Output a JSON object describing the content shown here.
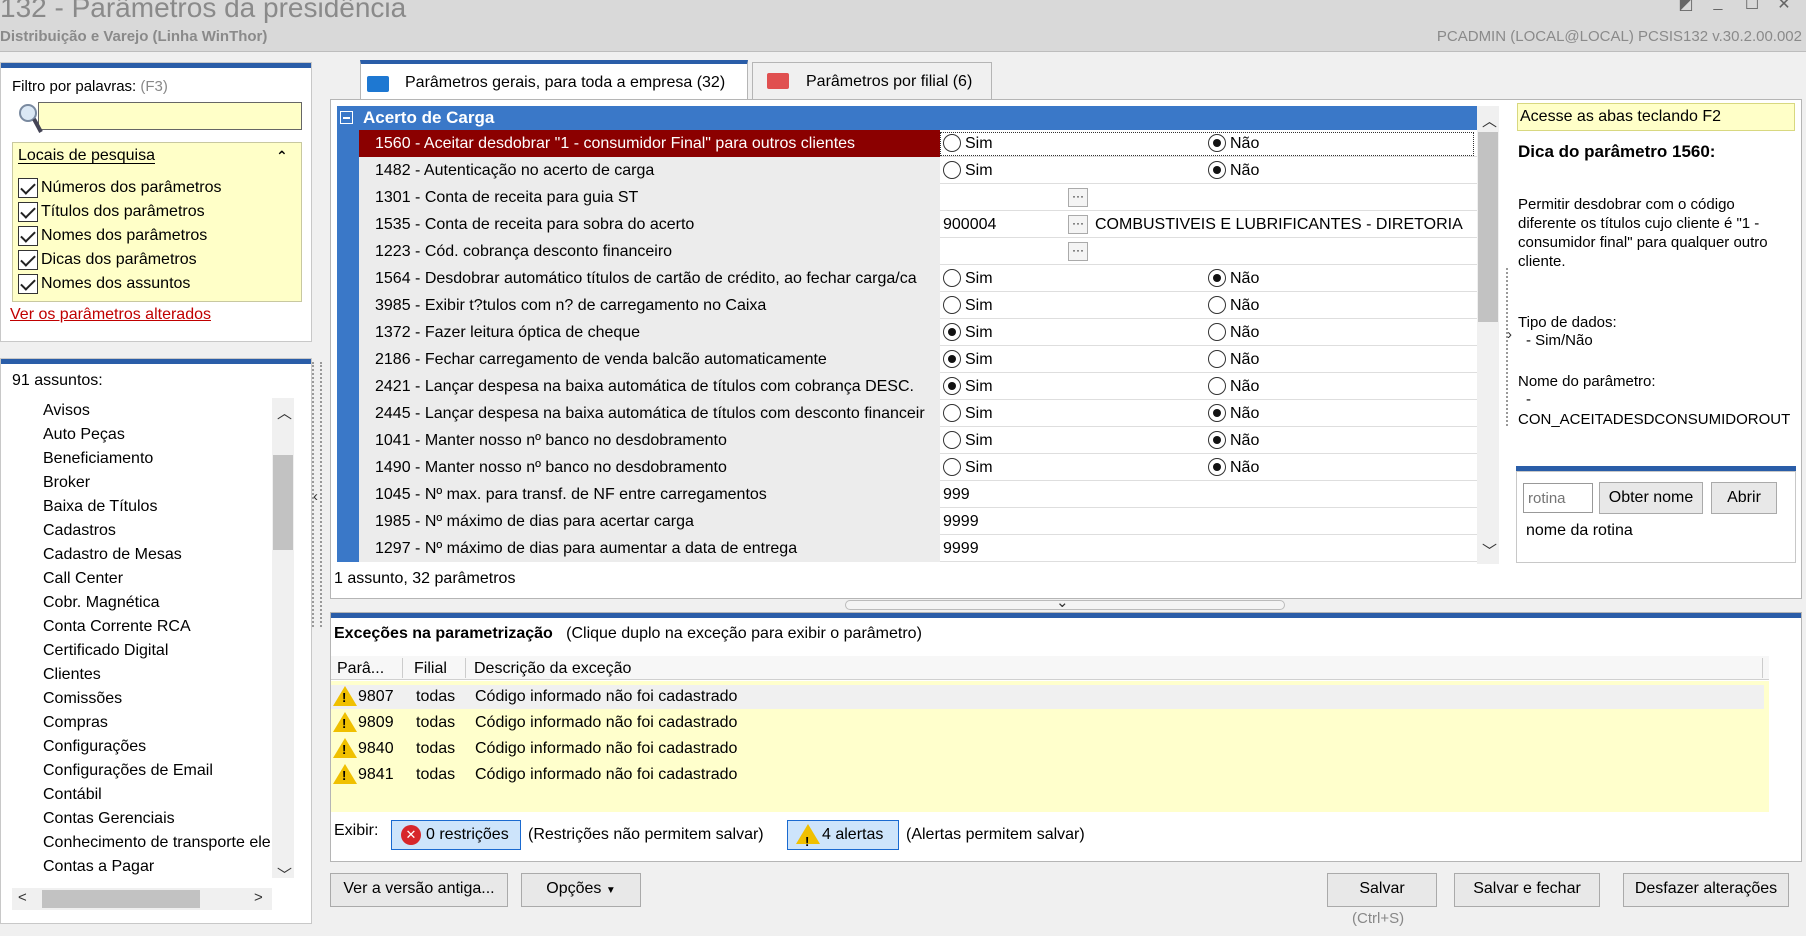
{
  "window": {
    "title": "132 - Parâmetros da presidência",
    "subtitle": "Distribuição e Varejo (Linha WinThor)",
    "userinfo": "PCADMIN (LOCAL@LOCAL)   PCSIS132  v.30.2.00.002"
  },
  "filter": {
    "label": "Filtro por palavras:",
    "shortcut": "(F3)",
    "value": "",
    "locais_title": "Locais de pesquisa",
    "options": [
      "Números dos parâmetros",
      "Títulos dos parâmetros",
      "Nomes dos parâmetros",
      "Dicas dos parâmetros",
      "Nomes dos assuntos"
    ],
    "ver_alterados": "Ver os parâmetros alterados"
  },
  "assuntos": {
    "title": "91 assuntos:",
    "items": [
      "Avisos",
      "Auto Peças",
      "Beneficiamento",
      "Broker",
      "Baixa de Títulos",
      "Cadastros",
      "Cadastro de Mesas",
      "Call Center",
      "Cobr. Magnética",
      "Conta Corrente RCA",
      "Certificado Digital",
      "Clientes",
      "Comissões",
      "Compras",
      "Configurações",
      "Configurações de Email",
      "Contábil",
      "Contas Gerenciais",
      "Conhecimento de transporte ele",
      "Contas a Pagar"
    ]
  },
  "tabs": [
    {
      "label": "Parâmetros gerais, para toda a empresa (32)",
      "color": "#1e78d2"
    },
    {
      "label": "Parâmetros por filial (6)",
      "color": "#e05050"
    }
  ],
  "grid": {
    "group": "Acerto de Carga",
    "radio_yes": "Sim",
    "radio_no": "Não",
    "rows": [
      {
        "name": "1560 - Aceitar desdobrar \"1 - consumidor Final\" para outros clientes",
        "kind": "radio",
        "value": "Não"
      },
      {
        "name": "1482 - Autenticação no acerto de carga",
        "kind": "radio",
        "value": "Não"
      },
      {
        "name": "1301 - Conta de receita para guia ST",
        "kind": "lookup",
        "code": "",
        "desc": ""
      },
      {
        "name": "1535 - Conta de receita para sobra do acerto",
        "kind": "lookup",
        "code": "900004",
        "desc": "COMBUSTIVEIS E LUBRIFICANTES - DIRETORIA"
      },
      {
        "name": "1223 - Cód. cobrança desconto financeiro",
        "kind": "lookup",
        "code": "",
        "desc": ""
      },
      {
        "name": "1564 - Desdobrar automático títulos de cartão de crédito, ao fechar carga/ca",
        "kind": "radio",
        "value": "Não"
      },
      {
        "name": "3985 - Exibir t?tulos com n? de carregamento no Caixa",
        "kind": "radio",
        "value": ""
      },
      {
        "name": "1372 - Fazer leitura óptica de cheque",
        "kind": "radio",
        "value": "Sim"
      },
      {
        "name": "2186 - Fechar carregamento de venda balcão automaticamente",
        "kind": "radio",
        "value": "Sim"
      },
      {
        "name": "2421 - Lançar despesa na baixa automática de títulos com cobrança DESC.",
        "kind": "radio",
        "value": "Sim"
      },
      {
        "name": "2445 - Lançar despesa na baixa automática de títulos com desconto financeir",
        "kind": "radio",
        "value": "Não"
      },
      {
        "name": "1041 - Manter nosso nº banco no desdobramento",
        "kind": "radio",
        "value": "Não"
      },
      {
        "name": "1490 - Manter nosso nº banco no desdobramento",
        "kind": "radio",
        "value": "Não"
      },
      {
        "name": "1045 - Nº max. para transf. de NF entre carregamentos",
        "kind": "text",
        "code": "999"
      },
      {
        "name": "1985 - Nº máximo de dias para acertar carga",
        "kind": "text",
        "code": "9999"
      },
      {
        "name": "1297 - Nº máximo de dias para aumentar a data de entrega",
        "kind": "text",
        "code": "9999"
      }
    ],
    "status": "1 assunto, 32 parâmetros"
  },
  "tip": {
    "f2": "Acesse as abas teclando F2",
    "title": "Dica do parâmetro 1560:",
    "text": "Permitir desdobrar com o código diferente os títulos cujo cliente é \"1 - consumidor final\" para qualquer outro cliente.",
    "tipo_label": "Tipo de dados:",
    "tipo_value": "- Sim/Não",
    "nome_label": "Nome do parâmetro:",
    "nome_dash": "-",
    "nome_value": "CON_ACEITADESDCONSUMIDOROUT",
    "rotina_placeholder": "rotina",
    "obter_nome": "Obter nome",
    "abrir": "Abrir",
    "nome_rotina": "nome da rotina"
  },
  "exceptions": {
    "title": "Exceções na parametrização",
    "hint": "(Clique duplo na exceção para exibir o parâmetro)",
    "columns": [
      "Parâ...",
      "Filial",
      "Descrição da exceção"
    ],
    "rows": [
      {
        "param": "9807",
        "filial": "todas",
        "desc": "Código informado não foi cadastrado"
      },
      {
        "param": "9809",
        "filial": "todas",
        "desc": "Código informado não foi cadastrado"
      },
      {
        "param": "9840",
        "filial": "todas",
        "desc": "Código informado não foi cadastrado"
      },
      {
        "param": "9841",
        "filial": "todas",
        "desc": "Código informado não foi cadastrado"
      }
    ],
    "exibir": "Exibir:",
    "restricoes_btn": "0 restrições",
    "restricoes_hint": "(Restrições não permitem salvar)",
    "alertas_btn": "4 alertas",
    "alertas_hint": "(Alertas permitem salvar)"
  },
  "footer": {
    "ver_versao": "Ver a versão antiga...",
    "opcoes": "Opções",
    "salvar": "Salvar",
    "ctrl_s": "(Ctrl+S)",
    "salvar_fechar": "Salvar e fechar",
    "desfazer": "Desfazer alterações"
  }
}
